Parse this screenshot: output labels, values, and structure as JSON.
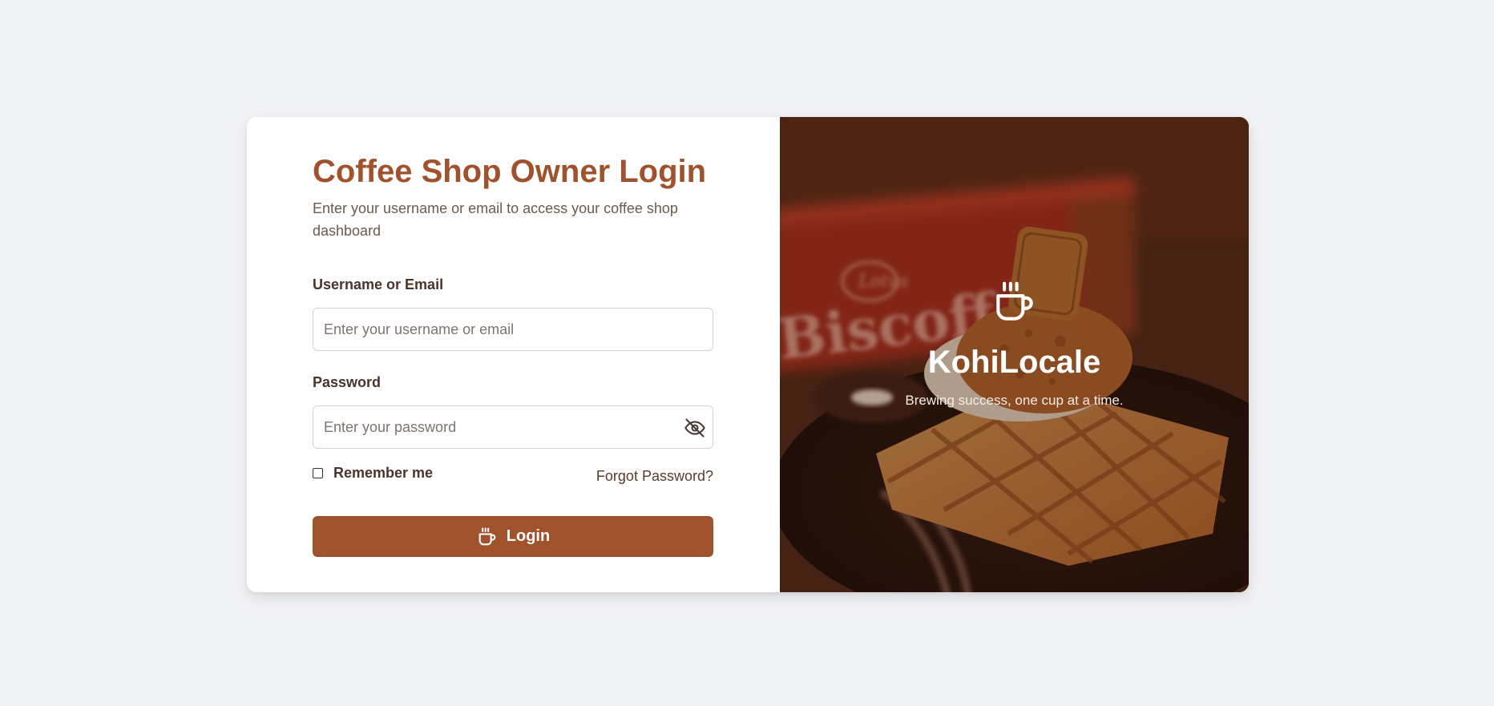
{
  "login": {
    "title": "Coffee Shop Owner Login",
    "subtitle": "Enter your username or email to access your coffee shop dashboard",
    "username_label": "Username or Email",
    "username_placeholder": "Enter your username or email",
    "password_label": "Password",
    "password_placeholder": "Enter your password",
    "remember_label": "Remember me",
    "forgot_label": "Forgot Password?",
    "login_button_label": "Login",
    "login_button_icon": "coffee-cup-icon",
    "password_toggle_icon": "eye-off-icon",
    "remember_checked": false
  },
  "brand": {
    "name": "KohiLocale",
    "tagline": "Brewing success, one cup at a time.",
    "icon": "coffee-cup-icon",
    "package_text": "Biscoff",
    "package_logo_text": "Lotus"
  },
  "colors": {
    "accent": "#a0522d",
    "page_background": "#f2f3f5",
    "hero_overlay": "#3b1f12"
  }
}
